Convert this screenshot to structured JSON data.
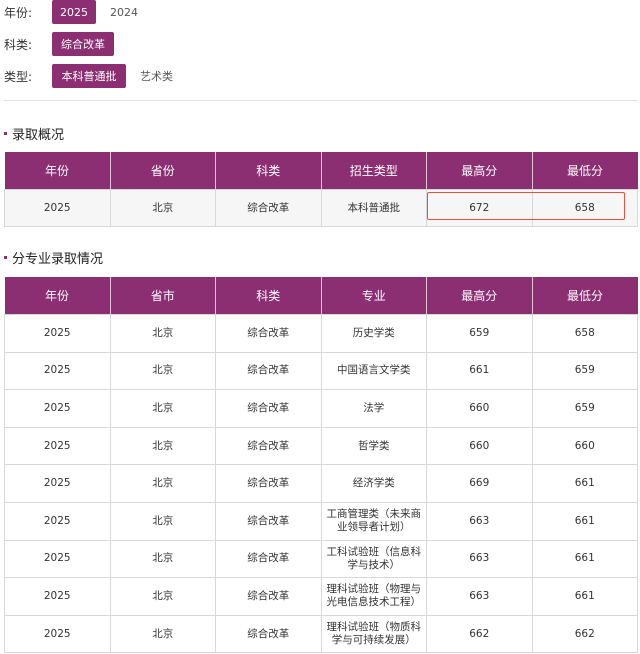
{
  "filters": {
    "year": {
      "label": "年份:",
      "options": [
        "2025",
        "2024"
      ],
      "selected": "2025"
    },
    "subject": {
      "label": "科类:",
      "options": [
        "综合改革"
      ],
      "selected": "综合改革"
    },
    "type": {
      "label": "类型:",
      "options": [
        "本科普通批",
        "艺术类"
      ],
      "selected": "本科普通批"
    }
  },
  "overview": {
    "title": "录取概况",
    "headers": [
      "年份",
      "省份",
      "科类",
      "招生类型",
      "最高分",
      "最低分"
    ],
    "row": [
      "2025",
      "北京",
      "综合改革",
      "本科普通批",
      "672",
      "658"
    ]
  },
  "majors": {
    "title": "分专业录取情况",
    "headers": [
      "年份",
      "省市",
      "科类",
      "专业",
      "最高分",
      "最低分"
    ],
    "rows": [
      [
        "2025",
        "北京",
        "综合改革",
        "历史学类",
        "659",
        "658"
      ],
      [
        "2025",
        "北京",
        "综合改革",
        "中国语言文学类",
        "661",
        "659"
      ],
      [
        "2025",
        "北京",
        "综合改革",
        "法学",
        "660",
        "659"
      ],
      [
        "2025",
        "北京",
        "综合改革",
        "哲学类",
        "660",
        "660"
      ],
      [
        "2025",
        "北京",
        "综合改革",
        "经济学类",
        "669",
        "661"
      ],
      [
        "2025",
        "北京",
        "综合改革",
        "工商管理类（未来商业领导者计划）",
        "663",
        "661"
      ],
      [
        "2025",
        "北京",
        "综合改革",
        "工科试验班（信息科学与技术）",
        "663",
        "661"
      ],
      [
        "2025",
        "北京",
        "综合改革",
        "理科试验班（物理与光电信息技术工程）",
        "663",
        "661"
      ],
      [
        "2025",
        "北京",
        "综合改革",
        "理科试验班（物质科学与可持续发展）",
        "662",
        "662"
      ]
    ]
  },
  "colors": {
    "accent": "#8c2f72",
    "highlight_border": "#e2533a"
  }
}
